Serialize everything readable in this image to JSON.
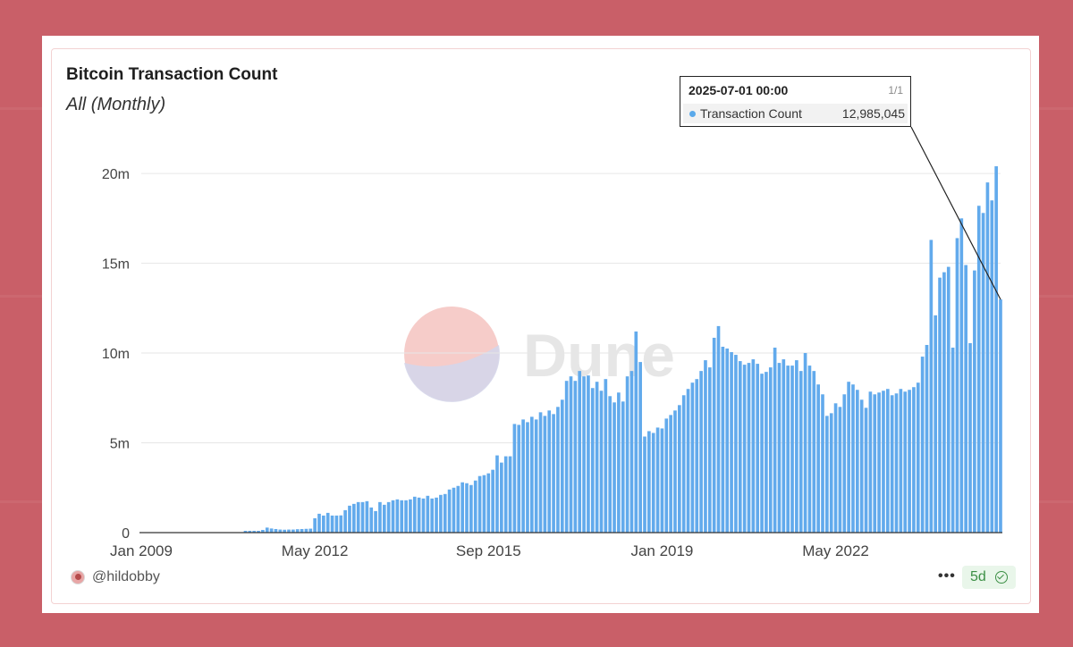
{
  "card": {
    "title": "Bitcoin Transaction Count",
    "subtitle": "All (Monthly)"
  },
  "watermark": {
    "text": "Dune"
  },
  "tooltip": {
    "date": "2025-07-01 00:00",
    "page": "1/1",
    "label": "Transaction Count",
    "value": "12,985,045"
  },
  "footer": {
    "user": "@hildobby",
    "age": "5d",
    "more": "•••"
  },
  "colors": {
    "bar": "#62aaec",
    "background": "#c95f68",
    "badge": "#3c8f45"
  },
  "chart_data": {
    "type": "bar",
    "series": [
      {
        "name": "Transaction Count",
        "color": "#62aaec"
      }
    ],
    "x_ticks": [
      "Jan 2009",
      "May 2012",
      "Sep 2015",
      "Jan 2019",
      "May 2022"
    ],
    "y_ticks": [
      "0",
      "5m",
      "10m",
      "15m",
      "20m"
    ],
    "ylim": [
      0,
      21000000
    ],
    "x_range": [
      "2009-01",
      "2025-07"
    ],
    "grid": true,
    "points": [
      [
        "2009-01",
        0
      ],
      [
        "2009-02",
        0
      ],
      [
        "2009-03",
        0
      ],
      [
        "2009-04",
        0
      ],
      [
        "2009-05",
        0
      ],
      [
        "2009-06",
        0
      ],
      [
        "2009-07",
        0
      ],
      [
        "2009-08",
        0
      ],
      [
        "2009-09",
        0
      ],
      [
        "2009-10",
        0
      ],
      [
        "2009-11",
        0
      ],
      [
        "2009-12",
        0
      ],
      [
        "2010-01",
        0
      ],
      [
        "2010-02",
        0
      ],
      [
        "2010-03",
        0
      ],
      [
        "2010-04",
        0
      ],
      [
        "2010-05",
        0
      ],
      [
        "2010-06",
        0
      ],
      [
        "2010-07",
        0
      ],
      [
        "2010-08",
        0
      ],
      [
        "2010-09",
        0
      ],
      [
        "2010-10",
        0
      ],
      [
        "2010-11",
        0
      ],
      [
        "2010-12",
        0
      ],
      [
        "2011-01",
        100000
      ],
      [
        "2011-02",
        100000
      ],
      [
        "2011-03",
        100000
      ],
      [
        "2011-04",
        100000
      ],
      [
        "2011-05",
        150000
      ],
      [
        "2011-06",
        280000
      ],
      [
        "2011-07",
        230000
      ],
      [
        "2011-08",
        200000
      ],
      [
        "2011-09",
        170000
      ],
      [
        "2011-10",
        160000
      ],
      [
        "2011-11",
        170000
      ],
      [
        "2011-12",
        170000
      ],
      [
        "2012-01",
        190000
      ],
      [
        "2012-02",
        200000
      ],
      [
        "2012-03",
        210000
      ],
      [
        "2012-04",
        220000
      ],
      [
        "2012-05",
        800000
      ],
      [
        "2012-06",
        1050000
      ],
      [
        "2012-07",
        950000
      ],
      [
        "2012-08",
        1100000
      ],
      [
        "2012-09",
        950000
      ],
      [
        "2012-10",
        950000
      ],
      [
        "2012-11",
        960000
      ],
      [
        "2012-12",
        1250000
      ],
      [
        "2013-01",
        1500000
      ],
      [
        "2013-02",
        1600000
      ],
      [
        "2013-03",
        1700000
      ],
      [
        "2013-04",
        1700000
      ],
      [
        "2013-05",
        1750000
      ],
      [
        "2013-06",
        1400000
      ],
      [
        "2013-07",
        1200000
      ],
      [
        "2013-08",
        1700000
      ],
      [
        "2013-09",
        1550000
      ],
      [
        "2013-10",
        1700000
      ],
      [
        "2013-11",
        1800000
      ],
      [
        "2013-12",
        1850000
      ],
      [
        "2014-01",
        1800000
      ],
      [
        "2014-02",
        1800000
      ],
      [
        "2014-03",
        1850000
      ],
      [
        "2014-04",
        2000000
      ],
      [
        "2014-05",
        1950000
      ],
      [
        "2014-06",
        1900000
      ],
      [
        "2014-07",
        2050000
      ],
      [
        "2014-08",
        1900000
      ],
      [
        "2014-09",
        1950000
      ],
      [
        "2014-10",
        2100000
      ],
      [
        "2014-11",
        2150000
      ],
      [
        "2014-12",
        2400000
      ],
      [
        "2015-01",
        2500000
      ],
      [
        "2015-02",
        2600000
      ],
      [
        "2015-03",
        2800000
      ],
      [
        "2015-04",
        2750000
      ],
      [
        "2015-05",
        2650000
      ],
      [
        "2015-06",
        2900000
      ],
      [
        "2015-07",
        3150000
      ],
      [
        "2015-08",
        3200000
      ],
      [
        "2015-09",
        3300000
      ],
      [
        "2015-10",
        3500000
      ],
      [
        "2015-11",
        4300000
      ],
      [
        "2015-12",
        3900000
      ],
      [
        "2016-01",
        4250000
      ],
      [
        "2016-02",
        4250000
      ],
      [
        "2016-03",
        6050000
      ],
      [
        "2016-04",
        6000000
      ],
      [
        "2016-05",
        6300000
      ],
      [
        "2016-06",
        6150000
      ],
      [
        "2016-07",
        6450000
      ],
      [
        "2016-08",
        6300000
      ],
      [
        "2016-09",
        6700000
      ],
      [
        "2016-10",
        6500000
      ],
      [
        "2016-11",
        6800000
      ],
      [
        "2016-12",
        6600000
      ],
      [
        "2017-01",
        7000000
      ],
      [
        "2017-02",
        7400000
      ],
      [
        "2017-03",
        8450000
      ],
      [
        "2017-04",
        8700000
      ],
      [
        "2017-05",
        8450000
      ],
      [
        "2017-06",
        9000000
      ],
      [
        "2017-07",
        8700000
      ],
      [
        "2017-08",
        8750000
      ],
      [
        "2017-09",
        8050000
      ],
      [
        "2017-10",
        8400000
      ],
      [
        "2017-11",
        7900000
      ],
      [
        "2017-12",
        8550000
      ],
      [
        "2018-01",
        7600000
      ],
      [
        "2018-02",
        7250000
      ],
      [
        "2018-03",
        7800000
      ],
      [
        "2018-04",
        7300000
      ],
      [
        "2018-05",
        8700000
      ],
      [
        "2018-06",
        9000000
      ],
      [
        "2018-07",
        11200000
      ],
      [
        "2018-08",
        9500000
      ],
      [
        "2018-09",
        5350000
      ],
      [
        "2018-10",
        5650000
      ],
      [
        "2018-11",
        5550000
      ],
      [
        "2018-12",
        5850000
      ],
      [
        "2019-01",
        5800000
      ],
      [
        "2019-02",
        6350000
      ],
      [
        "2019-03",
        6550000
      ],
      [
        "2019-04",
        6800000
      ],
      [
        "2019-05",
        7100000
      ],
      [
        "2019-06",
        7650000
      ],
      [
        "2019-07",
        8000000
      ],
      [
        "2019-08",
        8350000
      ],
      [
        "2019-09",
        8550000
      ],
      [
        "2019-10",
        9000000
      ],
      [
        "2019-11",
        9600000
      ],
      [
        "2019-12",
        9200000
      ],
      [
        "2020-01",
        10850000
      ],
      [
        "2020-02",
        11500000
      ],
      [
        "2020-03",
        10350000
      ],
      [
        "2020-04",
        10250000
      ],
      [
        "2020-05",
        10050000
      ],
      [
        "2020-06",
        9900000
      ],
      [
        "2020-07",
        9550000
      ],
      [
        "2020-08",
        9350000
      ],
      [
        "2020-09",
        9450000
      ],
      [
        "2020-10",
        9650000
      ],
      [
        "2020-11",
        9400000
      ],
      [
        "2020-12",
        8850000
      ],
      [
        "2021-01",
        8950000
      ],
      [
        "2021-02",
        9200000
      ],
      [
        "2021-03",
        10300000
      ],
      [
        "2021-04",
        9450000
      ],
      [
        "2021-05",
        9650000
      ],
      [
        "2021-06",
        9300000
      ],
      [
        "2021-07",
        9300000
      ],
      [
        "2021-08",
        9600000
      ],
      [
        "2021-09",
        9000000
      ],
      [
        "2021-10",
        10000000
      ],
      [
        "2021-11",
        9300000
      ],
      [
        "2021-12",
        9000000
      ],
      [
        "2022-01",
        8250000
      ],
      [
        "2022-02",
        7700000
      ],
      [
        "2022-03",
        6500000
      ],
      [
        "2022-04",
        6650000
      ],
      [
        "2022-05",
        7200000
      ],
      [
        "2022-06",
        7000000
      ],
      [
        "2022-07",
        7700000
      ],
      [
        "2022-08",
        8400000
      ],
      [
        "2022-09",
        8250000
      ],
      [
        "2022-10",
        7950000
      ],
      [
        "2022-11",
        7400000
      ],
      [
        "2022-12",
        6950000
      ],
      [
        "2023-01",
        7850000
      ],
      [
        "2023-02",
        7700000
      ],
      [
        "2023-03",
        7800000
      ],
      [
        "2023-04",
        7900000
      ],
      [
        "2023-05",
        8000000
      ],
      [
        "2023-06",
        7650000
      ],
      [
        "2023-07",
        7750000
      ],
      [
        "2023-08",
        8000000
      ],
      [
        "2023-09",
        7850000
      ],
      [
        "2023-10",
        7950000
      ],
      [
        "2023-11",
        8100000
      ],
      [
        "2023-12",
        8350000
      ],
      [
        "2024-01",
        9800000
      ],
      [
        "2024-02",
        10450000
      ],
      [
        "2024-03",
        16300000
      ],
      [
        "2024-04",
        12100000
      ],
      [
        "2024-05",
        14200000
      ],
      [
        "2024-06",
        14500000
      ],
      [
        "2024-07",
        14800000
      ],
      [
        "2024-08",
        10300000
      ],
      [
        "2024-09",
        16400000
      ],
      [
        "2024-10",
        17500000
      ],
      [
        "2024-11",
        14900000
      ],
      [
        "2024-12",
        10550000
      ],
      [
        "2025-01",
        14600000
      ],
      [
        "2025-02",
        18200000
      ],
      [
        "2025-03",
        17800000
      ],
      [
        "2025-04",
        19500000
      ],
      [
        "2025-05",
        18500000
      ],
      [
        "2025-06",
        20400000
      ],
      [
        "2025-07",
        12985045
      ]
    ]
  }
}
